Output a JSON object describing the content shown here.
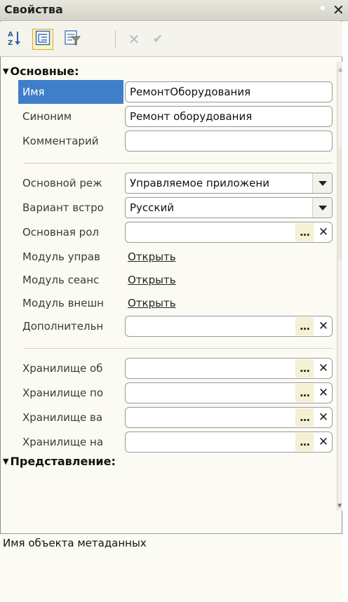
{
  "panel": {
    "title": "Свойства"
  },
  "toolbar": {
    "buttons": [
      "sort-az-icon",
      "categories-icon",
      "filter-icon",
      "delete-icon",
      "apply-icon"
    ]
  },
  "groups": {
    "main": "Основные:",
    "view": "Представление:"
  },
  "props": {
    "name": {
      "label": "Имя",
      "value": "РемонтОборудования"
    },
    "synonym": {
      "label": "Синоним",
      "value": "Ремонт оборудования"
    },
    "comment": {
      "label": "Комментарий",
      "value": ""
    },
    "run_mode": {
      "label": "Основной реж",
      "value": "Управляемое приложени"
    },
    "lang_variant": {
      "label": "Вариант встро",
      "value": "Русский"
    },
    "main_role": {
      "label": "Основная рол",
      "value": ""
    },
    "app_module": {
      "label": "Модуль управ",
      "link": "Открыть"
    },
    "session_module": {
      "label": "Модуль сеанс",
      "link": "Открыть"
    },
    "ext_module": {
      "label": "Модуль внешн",
      "link": "Открыть"
    },
    "additional": {
      "label": "Дополнительн",
      "value": ""
    },
    "storage1": {
      "label": "Хранилище об",
      "value": ""
    },
    "storage2": {
      "label": "Хранилище по",
      "value": ""
    },
    "storage3": {
      "label": "Хранилище ва",
      "value": ""
    },
    "storage4": {
      "label": "Хранилище на",
      "value": ""
    }
  },
  "buttons": {
    "pick": "...",
    "clear": "✕"
  },
  "description": "Имя объекта метаданных",
  "colors": {
    "selection": "#3f7fc9",
    "panel_bg": "#fbfbf3"
  }
}
